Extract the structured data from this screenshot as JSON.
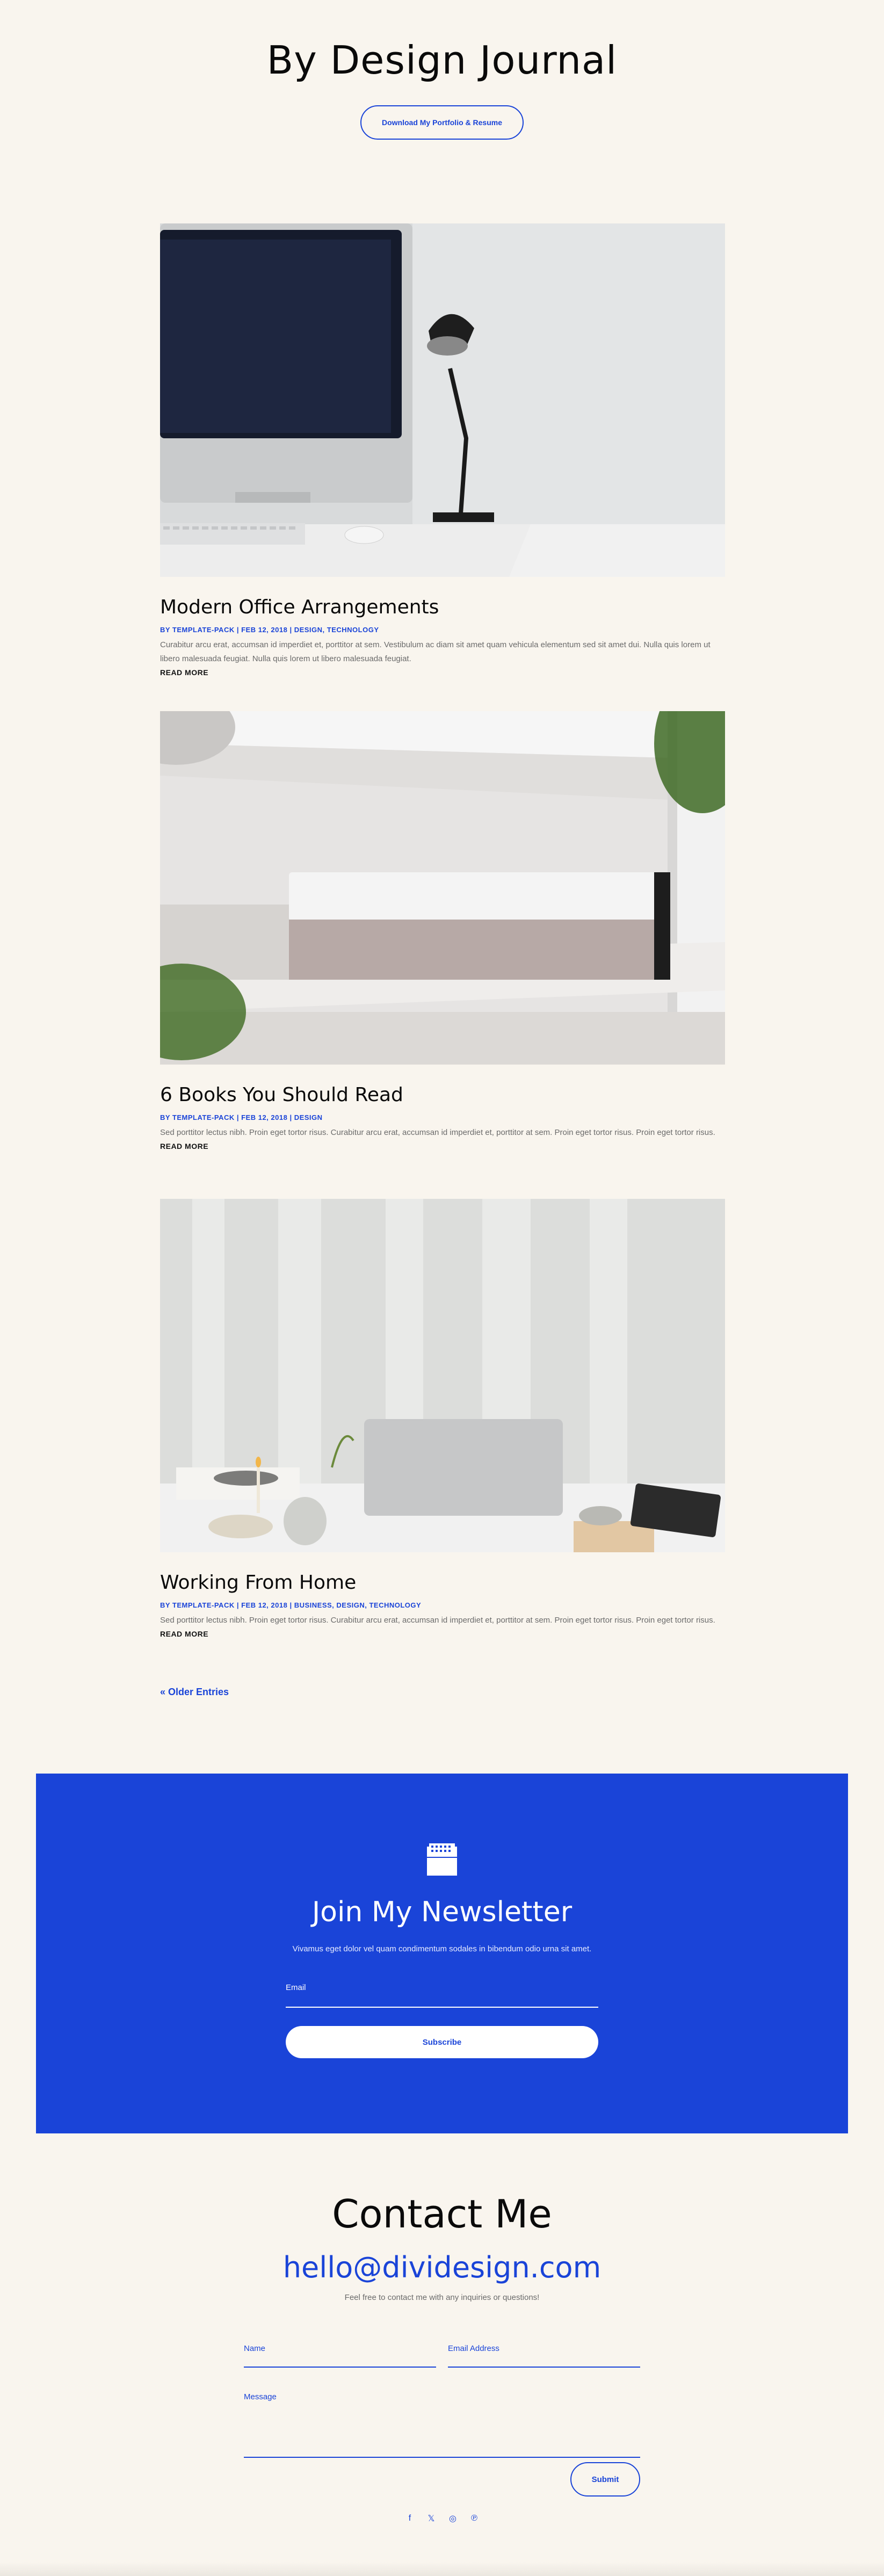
{
  "header": {
    "title": "By Design Journal",
    "button_label": "Download My Portfolio & Resume"
  },
  "posts": [
    {
      "title": "Modern Office Arrangements",
      "author": "BY TEMPLATE-PACK",
      "date": "FEB 12, 2018",
      "categories": "DESIGN, TECHNOLOGY",
      "excerpt": "Curabitur arcu erat, accumsan id imperdiet et, porttitor at sem. Vestibulum ac diam sit amet quam vehicula elementum sed sit amet dui. Nulla quis lorem ut libero malesuada feugiat. Nulla quis lorem ut libero malesuada feugiat.",
      "read_more": "READ MORE"
    },
    {
      "title": "6 Books You Should Read",
      "author": "BY TEMPLATE-PACK",
      "date": "FEB 12, 2018",
      "categories": "DESIGN",
      "excerpt": "Sed porttitor lectus nibh. Proin eget tortor risus. Curabitur arcu erat, accumsan id imperdiet et, porttitor at sem. Proin eget tortor risus. Proin eget tortor risus.",
      "read_more": "READ MORE"
    },
    {
      "title": "Working From Home",
      "author": "BY TEMPLATE-PACK",
      "date": "FEB 12, 2018",
      "categories": "BUSINESS, DESIGN, TECHNOLOGY",
      "excerpt": "Sed porttitor lectus nibh. Proin eget tortor risus. Curabitur arcu erat, accumsan id imperdiet et, porttitor at sem. Proin eget tortor risus. Proin eget tortor risus.",
      "read_more": "READ MORE"
    }
  ],
  "pagination": {
    "older_label": "« Older Entries"
  },
  "newsletter": {
    "title": "Join My Newsletter",
    "subtitle": "Vivamus eget dolor vel quam condimentum sodales in bibendum odio urna sit amet.",
    "email_label": "Email",
    "button_label": "Subscribe"
  },
  "contact": {
    "title": "Contact Me",
    "email": "hello@dividesign.com",
    "note": "Feel free to contact me with any inquiries or questions!",
    "name_label": "Name",
    "email_label": "Email Address",
    "message_label": "Message",
    "submit_label": "Submit"
  },
  "socials": [
    {
      "icon": "facebook-icon",
      "glyph": "f"
    },
    {
      "icon": "x-icon",
      "glyph": "𝕏"
    },
    {
      "icon": "instagram-icon",
      "glyph": "◎"
    },
    {
      "icon": "pinterest-icon",
      "glyph": "℗"
    }
  ],
  "colors": {
    "accent": "#1a44d8",
    "background": "#f9f5ee",
    "text": "#0a0a0a",
    "muted": "#6b6b6b"
  }
}
